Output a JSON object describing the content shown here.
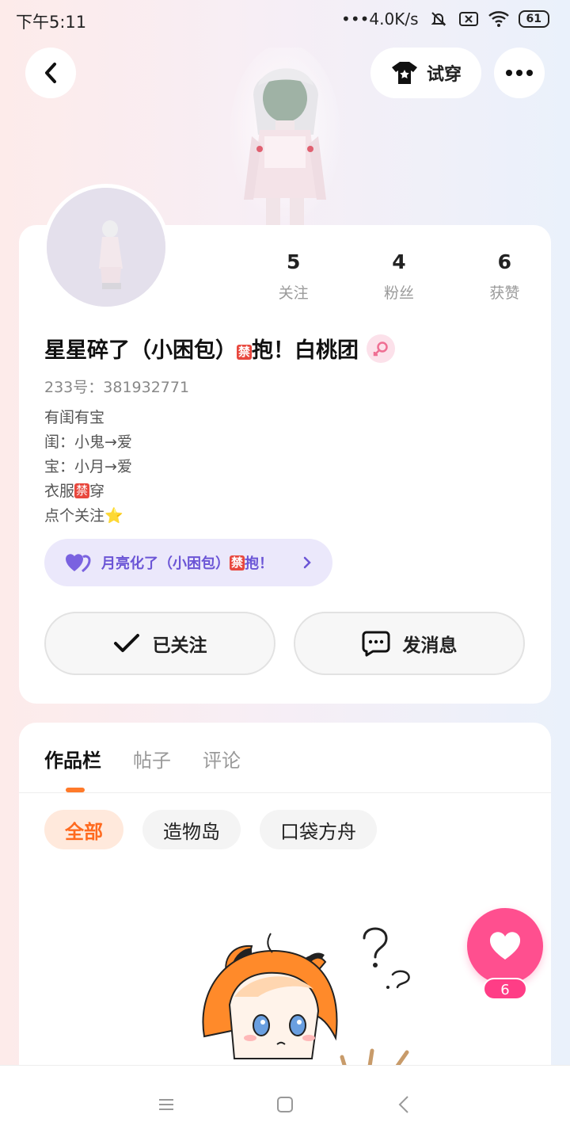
{
  "status_bar": {
    "time": "下午5:11",
    "network_speed": "•••4.0K/s",
    "battery": "61"
  },
  "header": {
    "try_on_label": "试穿"
  },
  "profile": {
    "stats": [
      {
        "value": "5",
        "label": "关注"
      },
      {
        "value": "4",
        "label": "粉丝"
      },
      {
        "value": "6",
        "label": "获赞"
      }
    ],
    "nickname_parts": {
      "before": "星星碎了（小困包）",
      "ban": "禁",
      "after": "抱！白桃团"
    },
    "uid": "233号：381932771",
    "bio": {
      "line1": "有闺有宝",
      "line2": "闺：小鬼→爱",
      "line3": "宝：小月→爱",
      "line4_before": "衣服",
      "line4_ban": "禁",
      "line4_after": "穿",
      "line5": "点个关注⭐"
    },
    "partner": {
      "before": "月亮化了（小困包）",
      "ban": "禁",
      "after": "抱！"
    },
    "follow_label": "已关注",
    "message_label": "发消息"
  },
  "content": {
    "tabs": [
      "作品栏",
      "帖子",
      "评论"
    ],
    "filters": [
      "全部",
      "造物岛",
      "口袋方舟"
    ]
  },
  "like": {
    "count": "6"
  },
  "colors": {
    "accent_orange": "#ff6a1f",
    "like_pink": "#ff4f8f",
    "partner_purple": "#6b55d6"
  }
}
